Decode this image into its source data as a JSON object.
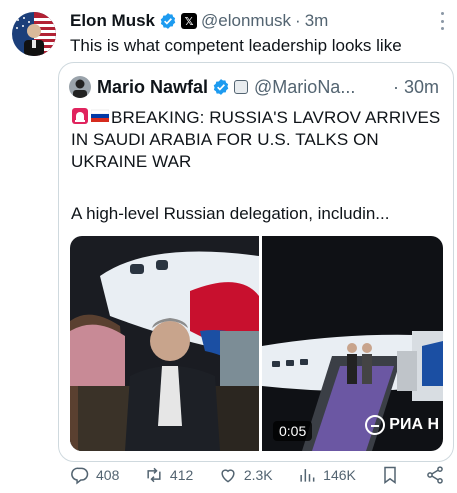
{
  "author": {
    "name": "Elon Musk",
    "handle": "@elonmusk",
    "separator": "·",
    "time": "3m",
    "text": "This is what competent leadership looks like",
    "x_badge": "𝕏"
  },
  "quoted": {
    "name": "Mario Nawfal",
    "handle": "@MarioNa...",
    "separator": "·",
    "time": "30m",
    "headline": "BREAKING: RUSSIA'S LAVROV ARRIVES IN SAUDI ARABIA FOR U.S. TALKS ON UKRAINE WAR",
    "snippet": "A high-level Russian delegation, includin...",
    "media": {
      "duration": "0:05",
      "watermark": "РИА Н"
    }
  },
  "actions": {
    "replies": "408",
    "reposts": "412",
    "likes": "2.3K",
    "views": "146K"
  },
  "colors": {
    "verified": "#1d9bf0",
    "muted": "#536471",
    "border": "#cfd9de"
  },
  "icons": [
    "verified-badge-icon",
    "x-logo-icon",
    "more-icon",
    "siren-icon",
    "russia-flag-icon",
    "reply-icon",
    "repost-icon",
    "like-icon",
    "views-icon",
    "bookmark-icon",
    "share-icon"
  ]
}
